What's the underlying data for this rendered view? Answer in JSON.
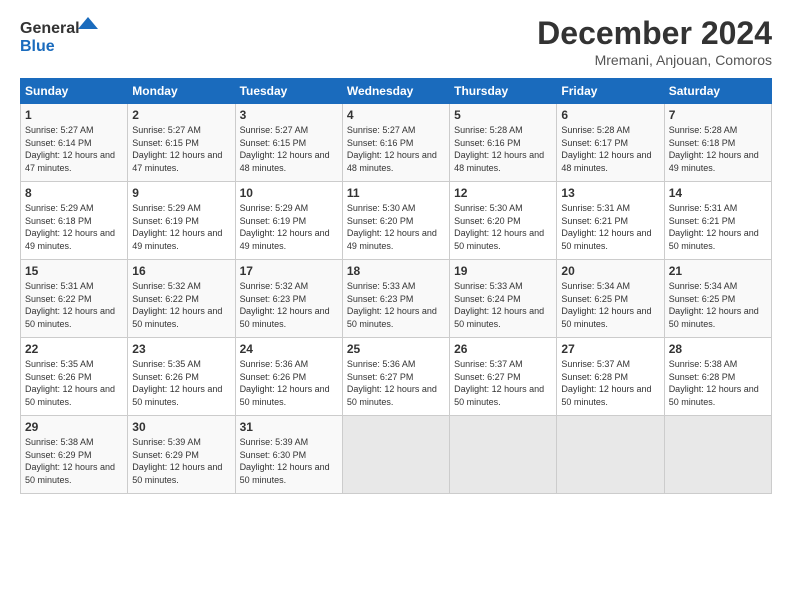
{
  "logo": {
    "line1": "General",
    "line2": "Blue"
  },
  "title": "December 2024",
  "location": "Mremani, Anjouan, Comoros",
  "days_of_week": [
    "Sunday",
    "Monday",
    "Tuesday",
    "Wednesday",
    "Thursday",
    "Friday",
    "Saturday"
  ],
  "weeks": [
    [
      {
        "day": "1",
        "sunrise": "5:27 AM",
        "sunset": "6:14 PM",
        "daylight": "12 hours and 47 minutes."
      },
      {
        "day": "2",
        "sunrise": "5:27 AM",
        "sunset": "6:15 PM",
        "daylight": "12 hours and 47 minutes."
      },
      {
        "day": "3",
        "sunrise": "5:27 AM",
        "sunset": "6:15 PM",
        "daylight": "12 hours and 48 minutes."
      },
      {
        "day": "4",
        "sunrise": "5:27 AM",
        "sunset": "6:16 PM",
        "daylight": "12 hours and 48 minutes."
      },
      {
        "day": "5",
        "sunrise": "5:28 AM",
        "sunset": "6:16 PM",
        "daylight": "12 hours and 48 minutes."
      },
      {
        "day": "6",
        "sunrise": "5:28 AM",
        "sunset": "6:17 PM",
        "daylight": "12 hours and 48 minutes."
      },
      {
        "day": "7",
        "sunrise": "5:28 AM",
        "sunset": "6:18 PM",
        "daylight": "12 hours and 49 minutes."
      }
    ],
    [
      {
        "day": "8",
        "sunrise": "5:29 AM",
        "sunset": "6:18 PM",
        "daylight": "12 hours and 49 minutes."
      },
      {
        "day": "9",
        "sunrise": "5:29 AM",
        "sunset": "6:19 PM",
        "daylight": "12 hours and 49 minutes."
      },
      {
        "day": "10",
        "sunrise": "5:29 AM",
        "sunset": "6:19 PM",
        "daylight": "12 hours and 49 minutes."
      },
      {
        "day": "11",
        "sunrise": "5:30 AM",
        "sunset": "6:20 PM",
        "daylight": "12 hours and 49 minutes."
      },
      {
        "day": "12",
        "sunrise": "5:30 AM",
        "sunset": "6:20 PM",
        "daylight": "12 hours and 50 minutes."
      },
      {
        "day": "13",
        "sunrise": "5:31 AM",
        "sunset": "6:21 PM",
        "daylight": "12 hours and 50 minutes."
      },
      {
        "day": "14",
        "sunrise": "5:31 AM",
        "sunset": "6:21 PM",
        "daylight": "12 hours and 50 minutes."
      }
    ],
    [
      {
        "day": "15",
        "sunrise": "5:31 AM",
        "sunset": "6:22 PM",
        "daylight": "12 hours and 50 minutes."
      },
      {
        "day": "16",
        "sunrise": "5:32 AM",
        "sunset": "6:22 PM",
        "daylight": "12 hours and 50 minutes."
      },
      {
        "day": "17",
        "sunrise": "5:32 AM",
        "sunset": "6:23 PM",
        "daylight": "12 hours and 50 minutes."
      },
      {
        "day": "18",
        "sunrise": "5:33 AM",
        "sunset": "6:23 PM",
        "daylight": "12 hours and 50 minutes."
      },
      {
        "day": "19",
        "sunrise": "5:33 AM",
        "sunset": "6:24 PM",
        "daylight": "12 hours and 50 minutes."
      },
      {
        "day": "20",
        "sunrise": "5:34 AM",
        "sunset": "6:25 PM",
        "daylight": "12 hours and 50 minutes."
      },
      {
        "day": "21",
        "sunrise": "5:34 AM",
        "sunset": "6:25 PM",
        "daylight": "12 hours and 50 minutes."
      }
    ],
    [
      {
        "day": "22",
        "sunrise": "5:35 AM",
        "sunset": "6:26 PM",
        "daylight": "12 hours and 50 minutes."
      },
      {
        "day": "23",
        "sunrise": "5:35 AM",
        "sunset": "6:26 PM",
        "daylight": "12 hours and 50 minutes."
      },
      {
        "day": "24",
        "sunrise": "5:36 AM",
        "sunset": "6:26 PM",
        "daylight": "12 hours and 50 minutes."
      },
      {
        "day": "25",
        "sunrise": "5:36 AM",
        "sunset": "6:27 PM",
        "daylight": "12 hours and 50 minutes."
      },
      {
        "day": "26",
        "sunrise": "5:37 AM",
        "sunset": "6:27 PM",
        "daylight": "12 hours and 50 minutes."
      },
      {
        "day": "27",
        "sunrise": "5:37 AM",
        "sunset": "6:28 PM",
        "daylight": "12 hours and 50 minutes."
      },
      {
        "day": "28",
        "sunrise": "5:38 AM",
        "sunset": "6:28 PM",
        "daylight": "12 hours and 50 minutes."
      }
    ],
    [
      {
        "day": "29",
        "sunrise": "5:38 AM",
        "sunset": "6:29 PM",
        "daylight": "12 hours and 50 minutes."
      },
      {
        "day": "30",
        "sunrise": "5:39 AM",
        "sunset": "6:29 PM",
        "daylight": "12 hours and 50 minutes."
      },
      {
        "day": "31",
        "sunrise": "5:39 AM",
        "sunset": "6:30 PM",
        "daylight": "12 hours and 50 minutes."
      },
      null,
      null,
      null,
      null
    ]
  ]
}
